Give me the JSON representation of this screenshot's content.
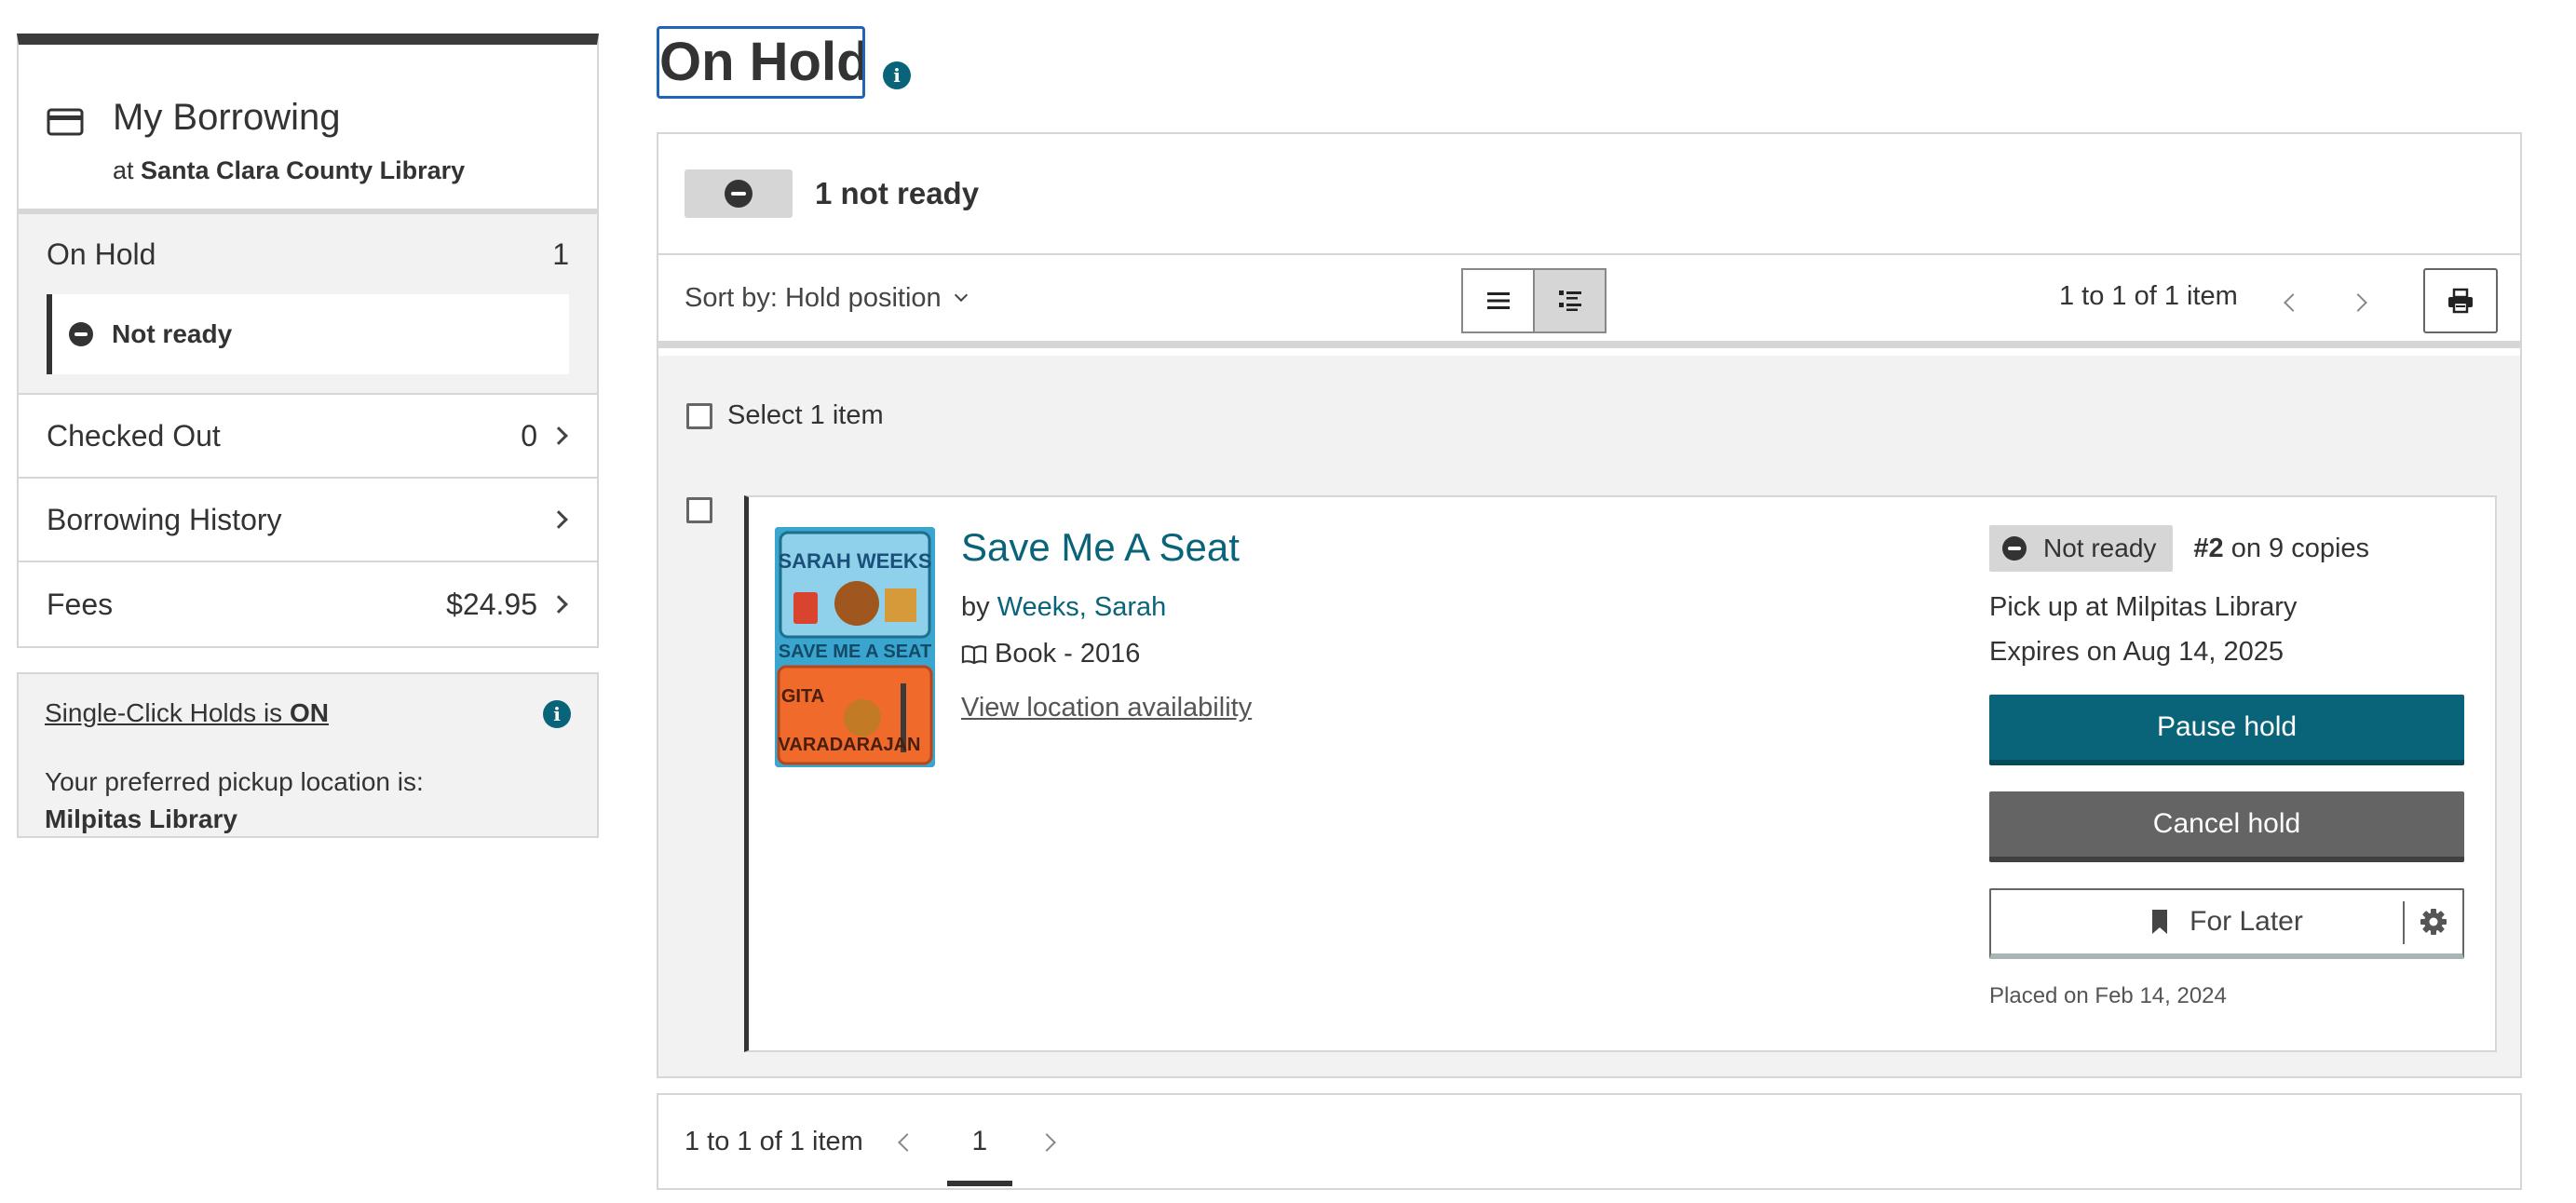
{
  "sidebar": {
    "title": "My Borrowing",
    "at_prefix": "at ",
    "library": "Santa Clara County Library",
    "on_hold_label": "On Hold",
    "on_hold_count": "1",
    "not_ready_label": "Not ready",
    "nav": [
      {
        "label": "Checked Out",
        "value": "0"
      },
      {
        "label": "Borrowing History",
        "value": ""
      },
      {
        "label": "Fees",
        "value": "$24.95"
      }
    ],
    "single_click_prefix": "Single-Click Holds is ",
    "single_click_state": "ON",
    "pickup_pref": "Your preferred pickup location is:",
    "pickup_location": "Milpitas Library"
  },
  "page": {
    "title": "On Hold",
    "status_summary": "1 not ready",
    "sort_label": "Sort by: Hold position",
    "range": "1 to 1 of 1 item",
    "select_all": "Select 1 item"
  },
  "item": {
    "title": "Save Me A Seat",
    "by_prefix": "by ",
    "author": "Weeks, Sarah",
    "format": "Book - 2016",
    "availability_link": "View location availability",
    "cover": {
      "line1": "SARAH WEEKS",
      "line2": "SAVE ME A SEAT",
      "line3": "GITA",
      "line4": "VARADARAJAN"
    },
    "status": "Not ready",
    "position": "#2",
    "position_suffix": " on 9 copies",
    "pickup": "Pick up at Milpitas Library",
    "expires": "Expires on Aug 14, 2025",
    "pause_label": "Pause hold",
    "cancel_label": "Cancel hold",
    "later_label": "For Later",
    "placed": "Placed on Feb 14, 2024"
  },
  "pager": {
    "range": "1 to 1 of 1 item",
    "current_page": "1"
  },
  "colors": {
    "accent": "#0a6479",
    "focus": "#1f64b8",
    "panel_gray": "#f2f2f2",
    "border": "#d6d6d6"
  }
}
